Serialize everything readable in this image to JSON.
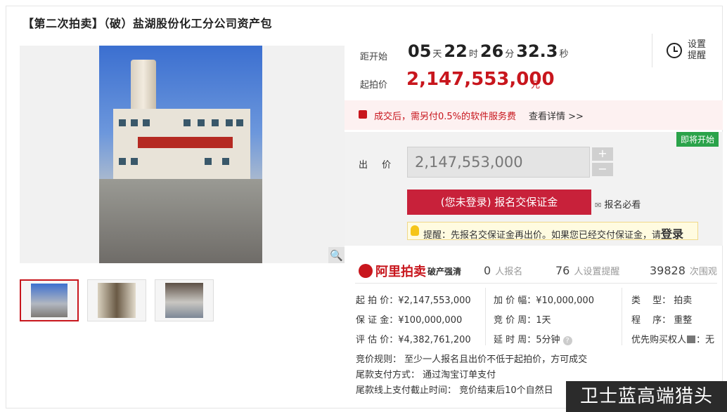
{
  "title": "【第二次拍卖】（破）盐湖股份化工分公司资产包",
  "countdown": {
    "label": "距开始",
    "days": "05",
    "days_unit": "天",
    "hours": "22",
    "hours_unit": "时",
    "minutes": "26",
    "minutes_unit": "分",
    "seconds": "32.3",
    "seconds_unit": "秒"
  },
  "remind": {
    "label": "设置提醒",
    "icon": "alarm-clock-icon"
  },
  "start_price": {
    "label": "起拍价",
    "value": "2,147,553,000",
    "unit": "元"
  },
  "fee": {
    "text": "成交后，需另付0.5%的软件服务费",
    "link": "查看详情 >>"
  },
  "bid": {
    "status": "即将开始",
    "label": "出 价",
    "value": "2,147,553,000",
    "plus": "+",
    "minus": "−",
    "register_button": "(您未登录) 报名交保证金",
    "notice_link": "报名必看",
    "tip": "提醒：先报名交保证金再出价。如果您已经交付保证金，请",
    "tip_login": "登录"
  },
  "brand": {
    "name": "阿里拍卖",
    "sub": "破产强清"
  },
  "stats": [
    {
      "value": "0",
      "label": "人报名"
    },
    {
      "value": "76",
      "label": "人设置提醒"
    },
    {
      "value": "39828",
      "label": "次围观"
    }
  ],
  "details": {
    "start_price": "起 拍 价：¥2,147,553,000",
    "deposit": "保 证 金：¥100,000,000",
    "estimate": "评 估 价：¥4,382,761,200",
    "increment": "加 价 幅：¥10,000,000",
    "cycle": "竞 价 周：1天",
    "extension": "延 时 周：5分钟",
    "type": "类　 型：",
    "type_value": "拍卖",
    "procedure": "程　 序：",
    "procedure_value": "重整",
    "priority": "优先购买权人",
    "priority_value": "：无"
  },
  "rules": {
    "bid_rule": "竞价规则：  至少一人报名且出价不低于起拍价，方可成交",
    "payment": "尾款支付方式：  通过淘宝订单支付",
    "deadline": "尾款线上支付截止时间：  竞价结束后10个自然日"
  },
  "watermark": "卫士蓝高端猎头",
  "colors": {
    "accent": "#c8161d",
    "status": "#2aa34a"
  }
}
